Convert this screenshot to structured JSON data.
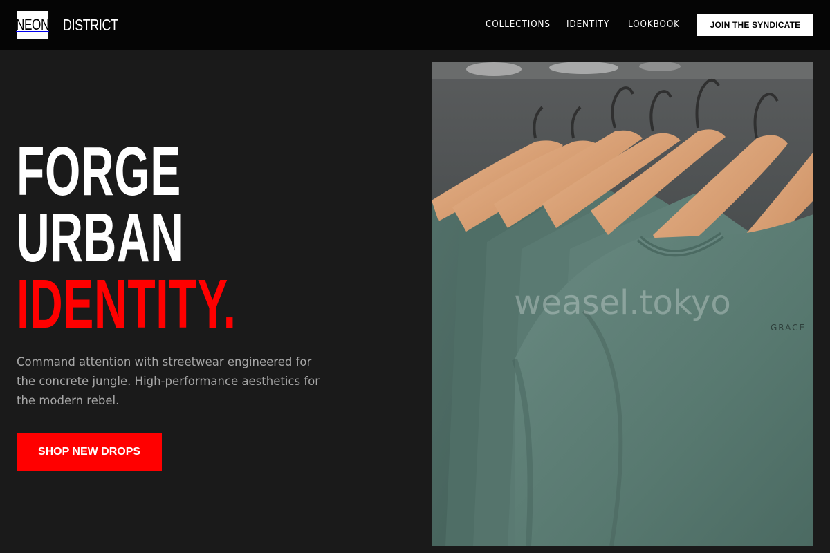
{
  "brand": {
    "logo_box_text": "NEON",
    "logo_text": "DISTRICT"
  },
  "nav": {
    "links": [
      {
        "label": "COLLECTIONS"
      },
      {
        "label": "IDENTITY"
      },
      {
        "label": "LOOKBOOK"
      }
    ],
    "cta_label": "JOIN THE SYNDICATE"
  },
  "hero": {
    "headline_line1": "FORGE",
    "headline_line2": "URBAN",
    "headline_line3": "IDENTITY.",
    "description": "Command attention with streetwear engineered for the concrete jungle. High-performance aesthetics for the modern rebel.",
    "cta_label": "SHOP NEW DROPS",
    "image": {
      "watermark": "weasel.tokyo",
      "shirt_label": "GRACE"
    }
  },
  "colors": {
    "accent": "#ff0000",
    "background": "#1a1a1a",
    "header_bg": "#050505",
    "shirt_green": "#5b7a72"
  }
}
